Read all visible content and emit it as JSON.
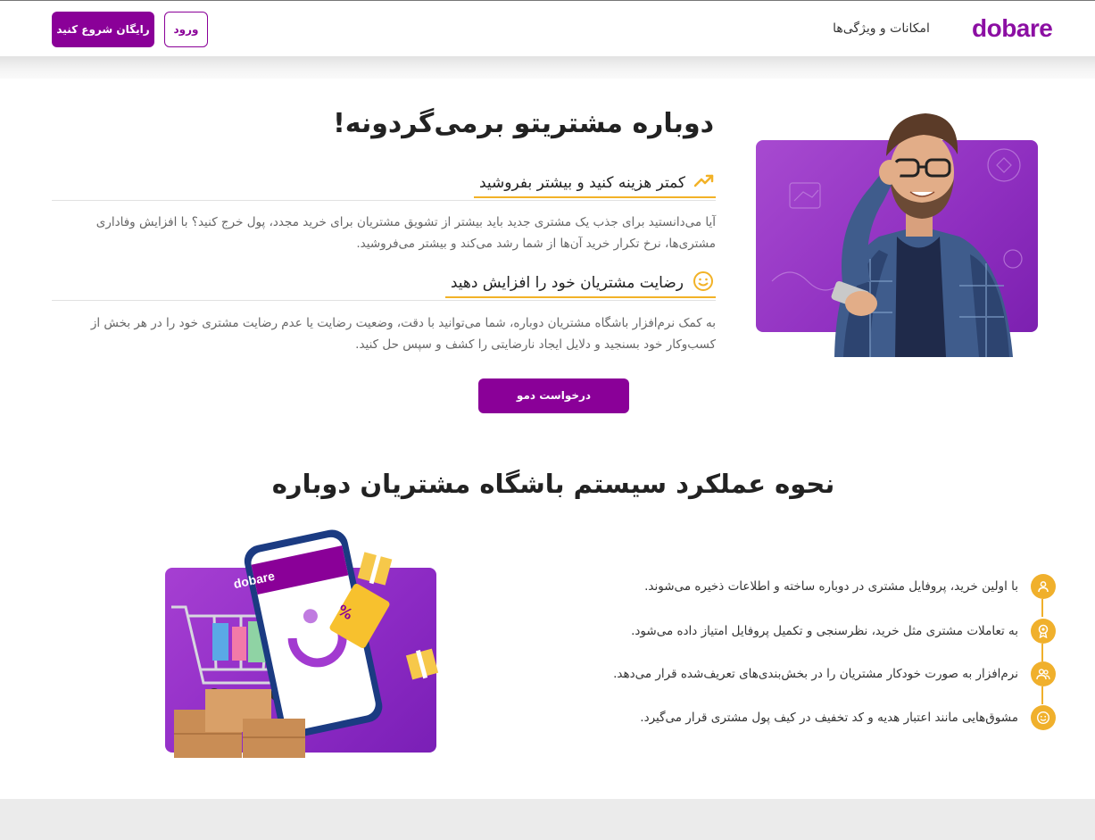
{
  "header": {
    "logo": "dobare",
    "nav_features": "امکانات و ویژگی‌ها",
    "login_label": "ورود",
    "start_label": "رایگان شروع کنید"
  },
  "hero": {
    "title": "دوباره مشتریتو برمی‌گردونه!",
    "features": [
      {
        "heading": "کمتر هزینه کنید و بیشتر بفروشید",
        "icon": "trending-up-icon",
        "body": "آیا می‌دانستید برای جذب یک مشتری جدید باید بیشتر از تشویق مشتریان برای خرید مجدد، پول خرج کنید؟ با افزایش وفاداری مشتری‌ها، نرخ تکرار خرید آن‌ها از شما رشد می‌کند و بیشتر می‌فروشید."
      },
      {
        "heading": "رضایت مشتریان خود را افزایش دهید",
        "icon": "smile-icon",
        "body": "به کمک نرم‌افزار باشگاه مشتریان دوباره، شما می‌توانید با دقت، وضعیت رضایت یا عدم رضایت مشتری خود را در هر بخش از کسب‌وکار خود بسنجید و دلایل ایجاد نارضایتی را کشف و سپس حل کنید."
      }
    ],
    "demo_label": "درخواست دمو"
  },
  "how": {
    "title": "نحوه عملکرد سیستم باشگاه مشتریان دوباره",
    "phone_logo": "dobare",
    "coupon_text": "%",
    "steps": [
      {
        "icon": "user-icon",
        "text": "با اولین خرید، پروفایل مشتری در دوباره ساخته و اطلاعات ذخیره می‌شوند."
      },
      {
        "icon": "badge-icon",
        "text": "به تعاملات مشتری مثل خرید، نظرسنجی و تکمیل پروفایل امتیاز داده می‌شود."
      },
      {
        "icon": "users-icon",
        "text": "نرم‌افزار به صورت خودکار مشتریان را در بخش‌بندی‌های تعریف‌شده قرار می‌دهد."
      },
      {
        "icon": "smile-icon",
        "text": "مشوق‌هایی مانند اعتبار هدیه و کد تخفیف در کیف پول مشتری قرار می‌گیرد."
      }
    ]
  },
  "colors": {
    "brand": "#8a0098",
    "accent": "#f0b02c",
    "image_bg": "#9b3ccb"
  }
}
